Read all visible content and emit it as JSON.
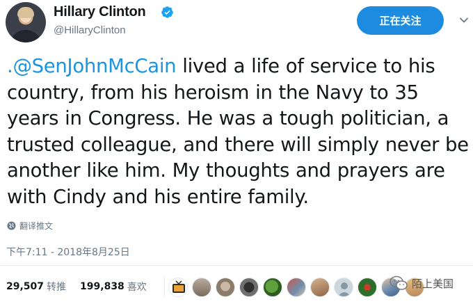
{
  "author": {
    "display_name": "Hillary Clinton",
    "handle": "@HillaryClinton"
  },
  "follow_button": {
    "label": "正在关注"
  },
  "tweet": {
    "mention": ".@SenJohnMcCain",
    "body": " lived a life of service to his country, from his heroism in the Navy to 35 years in Congress. He was a tough politician, a trusted colleague, and there will simply never be another like him. My thoughts and prayers are with Cindy and his entire family."
  },
  "translate_label": "翻译推文",
  "timestamp": "下午7:11 - 2018年8月25日",
  "stats": {
    "retweets_count": "29,507",
    "retweets_label": "转推",
    "likes_count": "199,838",
    "likes_label": "喜欢"
  },
  "watermark": {
    "text": "陌上美国"
  },
  "colors": {
    "accent": "#1d8ce0",
    "mention": "#1b95e0",
    "secondary_text": "#657786"
  },
  "icons": [
    "verified-badge-icon",
    "chevron-down-icon",
    "globe-icon",
    "wechat-icon"
  ]
}
